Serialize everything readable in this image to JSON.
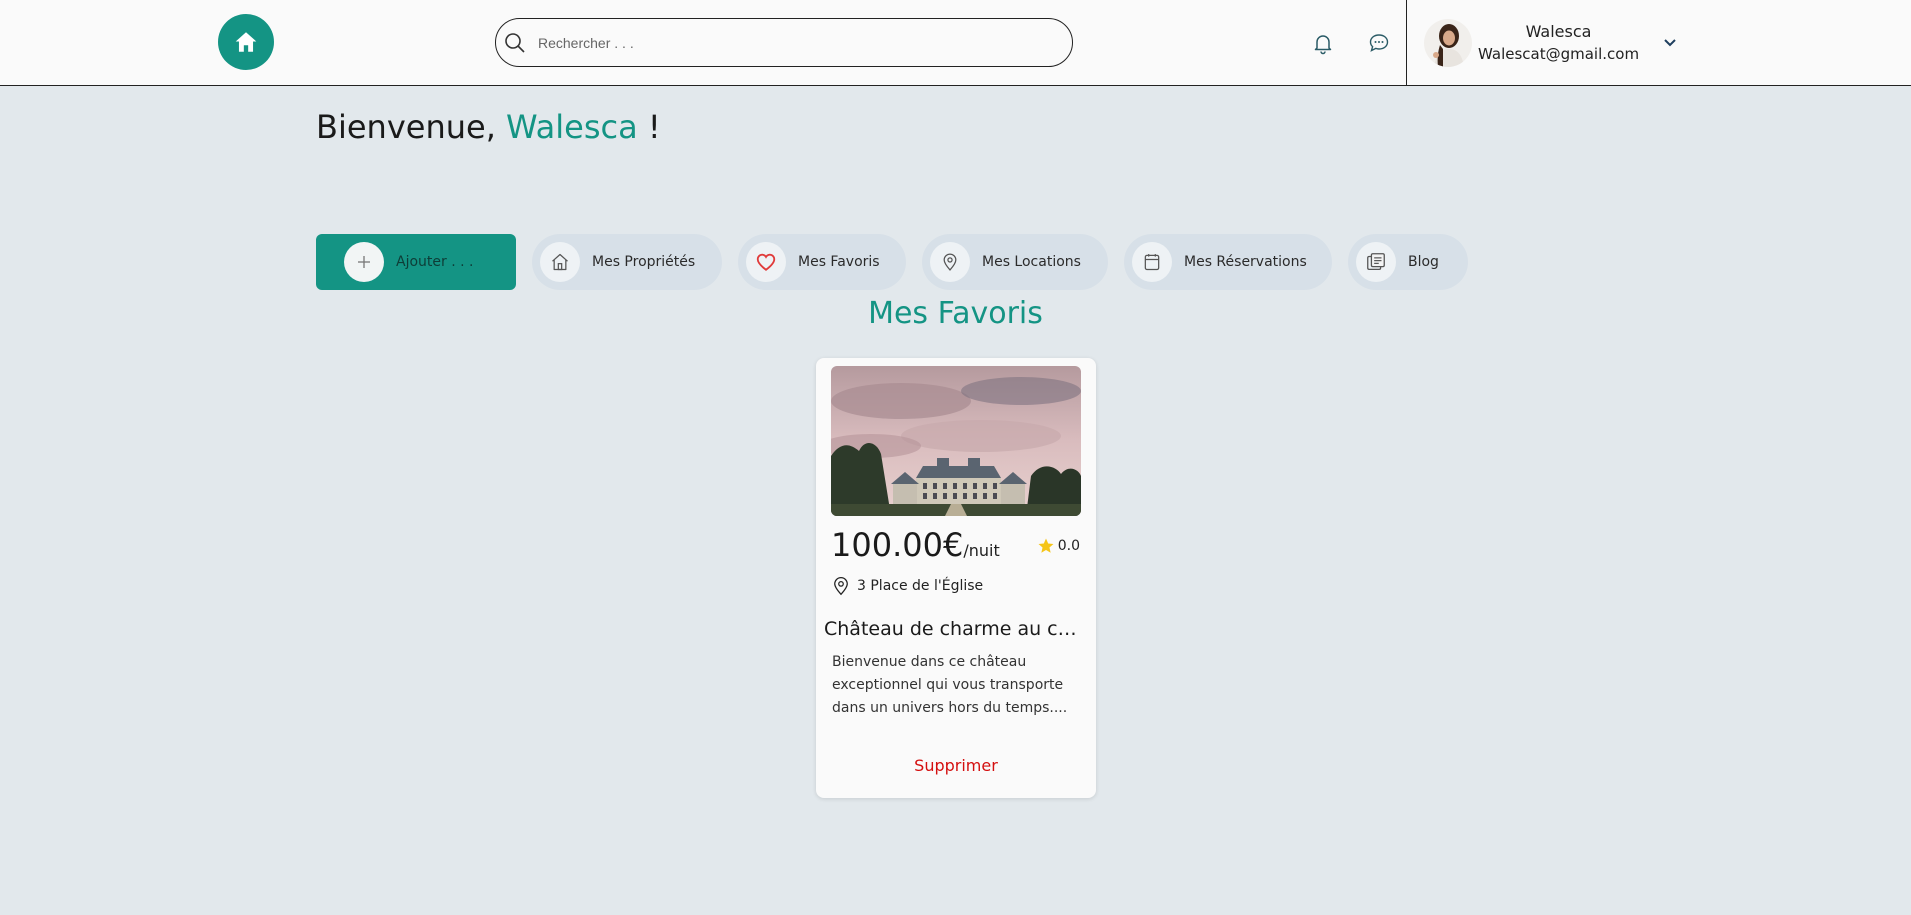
{
  "header": {
    "home_icon": "home-icon",
    "search": {
      "placeholder": "Rechercher . . .",
      "value": ""
    },
    "notifications_icon": "bell-icon",
    "messages_icon": "chat-icon",
    "user": {
      "name": "Walesca",
      "email": "Walescat@gmail.com"
    }
  },
  "welcome": {
    "prefix": "Bienvenue, ",
    "name": "Walesca",
    "suffix": " !"
  },
  "tabs": [
    {
      "label": "Ajouter . . .",
      "icon": "plus-icon"
    },
    {
      "label": "Mes Propriétés",
      "icon": "house-icon"
    },
    {
      "label": "Mes Favoris",
      "icon": "heart-icon"
    },
    {
      "label": "Mes Locations",
      "icon": "location-pin-icon"
    },
    {
      "label": "Mes Réservations",
      "icon": "calendar-icon"
    },
    {
      "label": "Blog",
      "icon": "blog-icon"
    }
  ],
  "section_title": "Mes Favoris",
  "favorites": [
    {
      "price": "100.00€",
      "price_unit": "/nuit",
      "rating": "0.0",
      "address": "3 Place de l'Église",
      "title": "Château de charme au cœur de la campagne",
      "description": "Bienvenue dans ce château exceptionnel qui vous transporte dans un univers hors du temps....",
      "delete_label": "Supprimer"
    }
  ],
  "colors": {
    "accent": "#149484",
    "danger": "#d40f0f",
    "star": "#f5c518"
  }
}
